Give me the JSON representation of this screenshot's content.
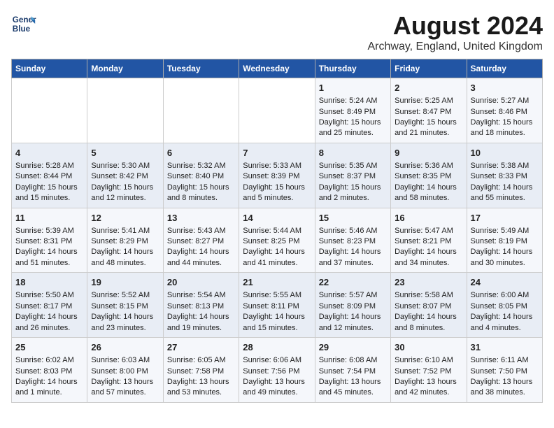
{
  "header": {
    "logo_line1": "General",
    "logo_line2": "Blue",
    "title": "August 2024",
    "subtitle": "Archway, England, United Kingdom"
  },
  "days_of_week": [
    "Sunday",
    "Monday",
    "Tuesday",
    "Wednesday",
    "Thursday",
    "Friday",
    "Saturday"
  ],
  "weeks": [
    [
      {
        "day": "",
        "content": ""
      },
      {
        "day": "",
        "content": ""
      },
      {
        "day": "",
        "content": ""
      },
      {
        "day": "",
        "content": ""
      },
      {
        "day": "1",
        "content": "Sunrise: 5:24 AM\nSunset: 8:49 PM\nDaylight: 15 hours\nand 25 minutes."
      },
      {
        "day": "2",
        "content": "Sunrise: 5:25 AM\nSunset: 8:47 PM\nDaylight: 15 hours\nand 21 minutes."
      },
      {
        "day": "3",
        "content": "Sunrise: 5:27 AM\nSunset: 8:46 PM\nDaylight: 15 hours\nand 18 minutes."
      }
    ],
    [
      {
        "day": "4",
        "content": "Sunrise: 5:28 AM\nSunset: 8:44 PM\nDaylight: 15 hours\nand 15 minutes."
      },
      {
        "day": "5",
        "content": "Sunrise: 5:30 AM\nSunset: 8:42 PM\nDaylight: 15 hours\nand 12 minutes."
      },
      {
        "day": "6",
        "content": "Sunrise: 5:32 AM\nSunset: 8:40 PM\nDaylight: 15 hours\nand 8 minutes."
      },
      {
        "day": "7",
        "content": "Sunrise: 5:33 AM\nSunset: 8:39 PM\nDaylight: 15 hours\nand 5 minutes."
      },
      {
        "day": "8",
        "content": "Sunrise: 5:35 AM\nSunset: 8:37 PM\nDaylight: 15 hours\nand 2 minutes."
      },
      {
        "day": "9",
        "content": "Sunrise: 5:36 AM\nSunset: 8:35 PM\nDaylight: 14 hours\nand 58 minutes."
      },
      {
        "day": "10",
        "content": "Sunrise: 5:38 AM\nSunset: 8:33 PM\nDaylight: 14 hours\nand 55 minutes."
      }
    ],
    [
      {
        "day": "11",
        "content": "Sunrise: 5:39 AM\nSunset: 8:31 PM\nDaylight: 14 hours\nand 51 minutes."
      },
      {
        "day": "12",
        "content": "Sunrise: 5:41 AM\nSunset: 8:29 PM\nDaylight: 14 hours\nand 48 minutes."
      },
      {
        "day": "13",
        "content": "Sunrise: 5:43 AM\nSunset: 8:27 PM\nDaylight: 14 hours\nand 44 minutes."
      },
      {
        "day": "14",
        "content": "Sunrise: 5:44 AM\nSunset: 8:25 PM\nDaylight: 14 hours\nand 41 minutes."
      },
      {
        "day": "15",
        "content": "Sunrise: 5:46 AM\nSunset: 8:23 PM\nDaylight: 14 hours\nand 37 minutes."
      },
      {
        "day": "16",
        "content": "Sunrise: 5:47 AM\nSunset: 8:21 PM\nDaylight: 14 hours\nand 34 minutes."
      },
      {
        "day": "17",
        "content": "Sunrise: 5:49 AM\nSunset: 8:19 PM\nDaylight: 14 hours\nand 30 minutes."
      }
    ],
    [
      {
        "day": "18",
        "content": "Sunrise: 5:50 AM\nSunset: 8:17 PM\nDaylight: 14 hours\nand 26 minutes."
      },
      {
        "day": "19",
        "content": "Sunrise: 5:52 AM\nSunset: 8:15 PM\nDaylight: 14 hours\nand 23 minutes."
      },
      {
        "day": "20",
        "content": "Sunrise: 5:54 AM\nSunset: 8:13 PM\nDaylight: 14 hours\nand 19 minutes."
      },
      {
        "day": "21",
        "content": "Sunrise: 5:55 AM\nSunset: 8:11 PM\nDaylight: 14 hours\nand 15 minutes."
      },
      {
        "day": "22",
        "content": "Sunrise: 5:57 AM\nSunset: 8:09 PM\nDaylight: 14 hours\nand 12 minutes."
      },
      {
        "day": "23",
        "content": "Sunrise: 5:58 AM\nSunset: 8:07 PM\nDaylight: 14 hours\nand 8 minutes."
      },
      {
        "day": "24",
        "content": "Sunrise: 6:00 AM\nSunset: 8:05 PM\nDaylight: 14 hours\nand 4 minutes."
      }
    ],
    [
      {
        "day": "25",
        "content": "Sunrise: 6:02 AM\nSunset: 8:03 PM\nDaylight: 14 hours\nand 1 minute."
      },
      {
        "day": "26",
        "content": "Sunrise: 6:03 AM\nSunset: 8:00 PM\nDaylight: 13 hours\nand 57 minutes."
      },
      {
        "day": "27",
        "content": "Sunrise: 6:05 AM\nSunset: 7:58 PM\nDaylight: 13 hours\nand 53 minutes."
      },
      {
        "day": "28",
        "content": "Sunrise: 6:06 AM\nSunset: 7:56 PM\nDaylight: 13 hours\nand 49 minutes."
      },
      {
        "day": "29",
        "content": "Sunrise: 6:08 AM\nSunset: 7:54 PM\nDaylight: 13 hours\nand 45 minutes."
      },
      {
        "day": "30",
        "content": "Sunrise: 6:10 AM\nSunset: 7:52 PM\nDaylight: 13 hours\nand 42 minutes."
      },
      {
        "day": "31",
        "content": "Sunrise: 6:11 AM\nSunset: 7:50 PM\nDaylight: 13 hours\nand 38 minutes."
      }
    ]
  ]
}
